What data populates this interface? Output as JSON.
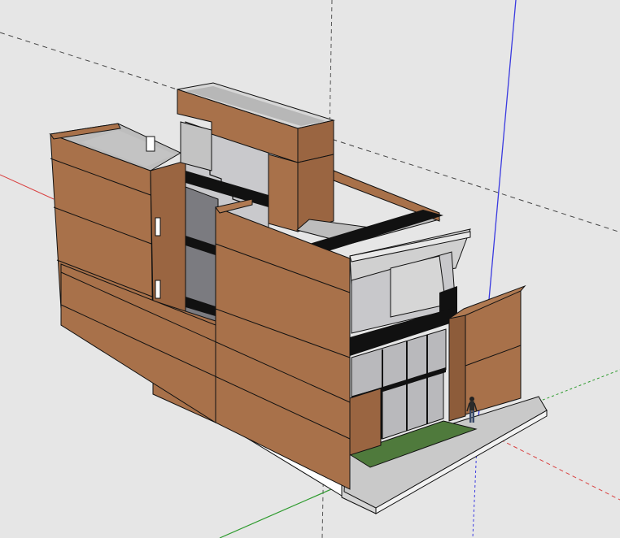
{
  "app": {
    "viewport_label": "",
    "tool": "orbit"
  },
  "scene": {
    "model_kind": "house-massing",
    "background_color": "#e6e6e6",
    "axis_colors": {
      "red": "#d94040",
      "green": "#2e9b2e",
      "blue": "#3a3ae0"
    },
    "material_colors": {
      "brick": "#a8714a",
      "brick_dark": "#8d5c3a",
      "concrete_roof": "#bdbdbd",
      "concrete_edge": "#d6d6d6",
      "glass": "#b9b9bc",
      "glass_dark": "#7b7b80",
      "lawn": "#4f7a3c",
      "pavement": "#c9c9c9",
      "plinth": "#ffffff",
      "band": "#111111"
    },
    "scale_figure": "human-figure-icon"
  }
}
